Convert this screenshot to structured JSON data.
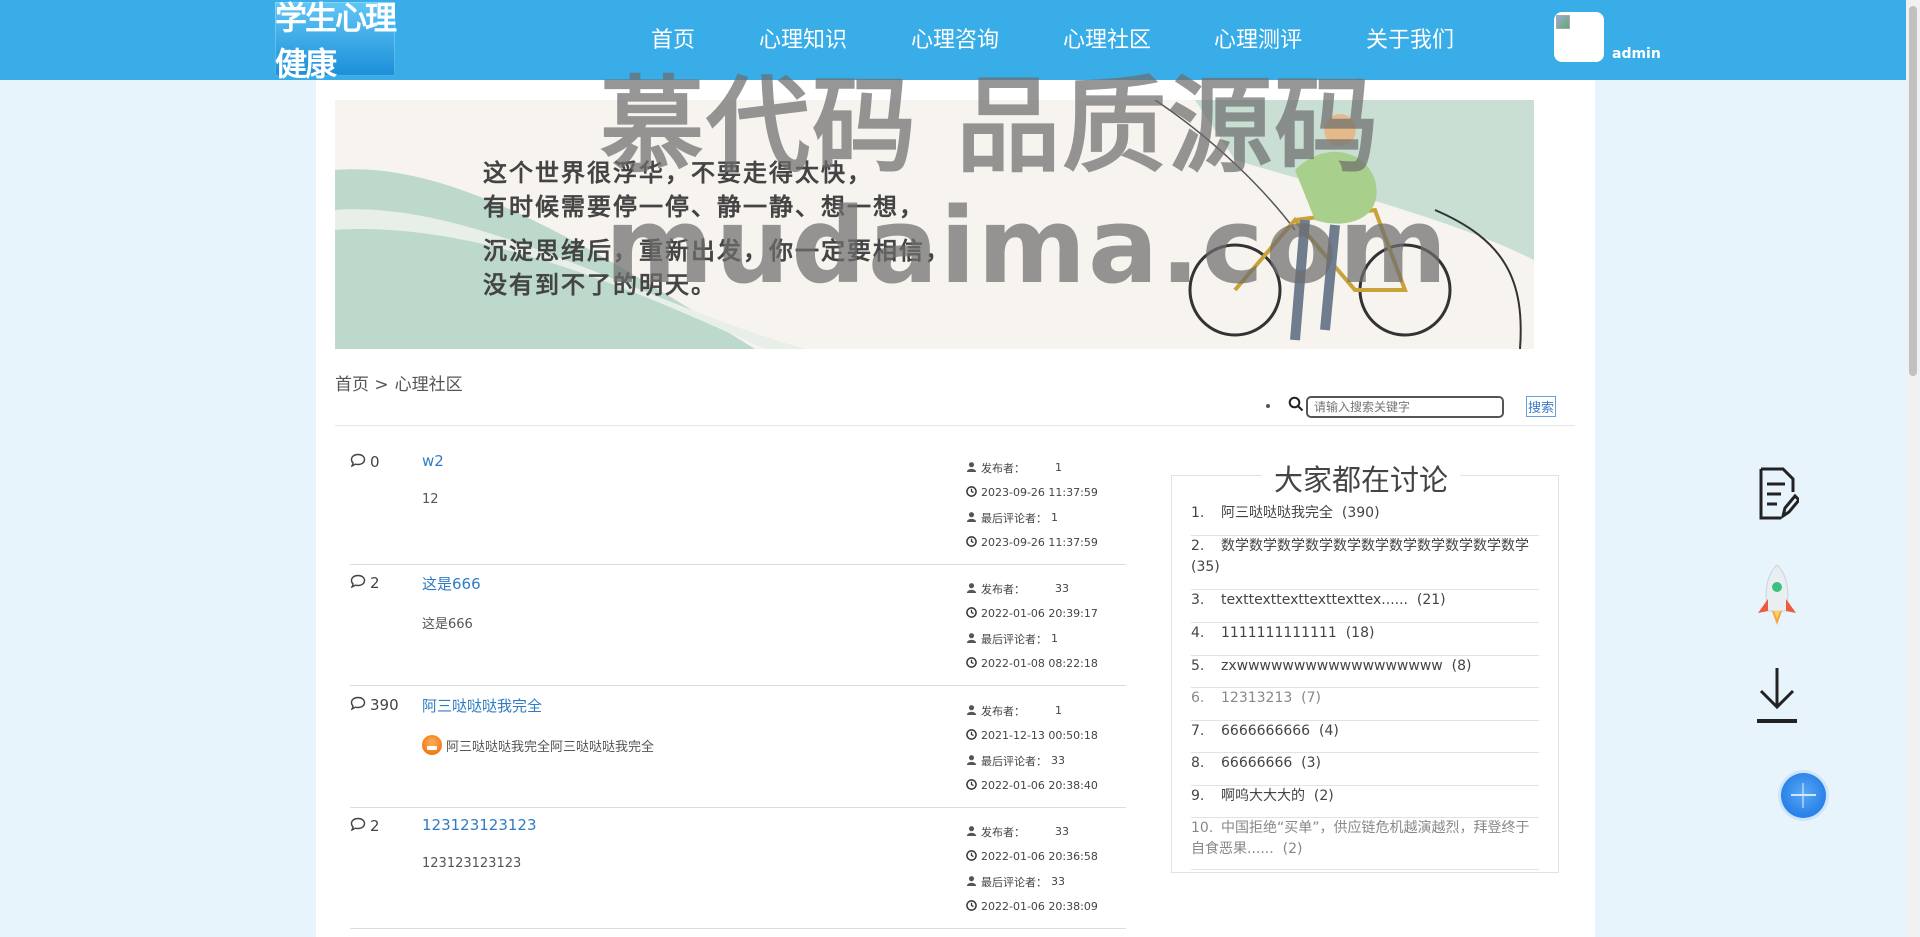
{
  "header": {
    "logo_text": "学生心理健康",
    "nav": [
      "首页",
      "心理知识",
      "心理咨询",
      "心理社区",
      "心理测评",
      "关于我们"
    ],
    "username": "admin"
  },
  "banner": {
    "lines": [
      "这个世界很浮华，不要走得太快，",
      "有时候需要停一停、静一静、想一想，",
      "沉淀思绪后，重新出发，你一定要相信，",
      "没有到不了的明天。"
    ]
  },
  "watermark": {
    "line1": "慕代码 品质源码",
    "line2": "mudaima.com"
  },
  "breadcrumb": {
    "home": "首页 >",
    "current": "心理社区"
  },
  "search": {
    "placeholder": "请输入搜索关键字",
    "button": "搜索"
  },
  "meta_labels": {
    "publisher": "发布者：",
    "last_commenter": "最后评论者："
  },
  "posts": [
    {
      "comments": "0",
      "title": "w2",
      "body": "12",
      "publisher": "1",
      "publish_time": "2023-09-26 11:37:59",
      "last_commenter": "1",
      "last_time": "2023-09-26 11:37:59"
    },
    {
      "comments": "2",
      "title": "这是666",
      "body": "这是666",
      "publisher": "33",
      "publish_time": "2022-01-06 20:39:17",
      "last_commenter": "1",
      "last_time": "2022-01-08 08:22:18"
    },
    {
      "comments": "390",
      "title": "阿三哒哒哒我完全",
      "body": "阿三哒哒哒我完全阿三哒哒哒我完全",
      "publisher": "1",
      "publish_time": "2021-12-13 00:50:18",
      "last_commenter": "33",
      "last_time": "2022-01-06 20:38:40"
    },
    {
      "comments": "2",
      "title": "123123123123",
      "body": "123123123123",
      "publisher": "33",
      "publish_time": "2022-01-06 20:36:58",
      "last_commenter": "33",
      "last_time": "2022-01-06 20:38:09"
    }
  ],
  "discussion": {
    "title": "大家都在讨论",
    "items": [
      {
        "num": "1.",
        "text": "阿三哒哒哒我完全",
        "count": "(390)"
      },
      {
        "num": "2.",
        "text": "数学数学数学数学数学数学数学数学数学数学数学",
        "count": "(35)"
      },
      {
        "num": "3.",
        "text": "texttexttexttexttexttex......",
        "count": "(21)"
      },
      {
        "num": "4.",
        "text": "1111111111111",
        "count": "(18)"
      },
      {
        "num": "5.",
        "text": "zxwwwwwwwwwwwwwwwwww",
        "count": "(8)"
      },
      {
        "num": "6.",
        "text": "12313213",
        "count": "(7)"
      },
      {
        "num": "7.",
        "text": "6666666666",
        "count": "(4)"
      },
      {
        "num": "8.",
        "text": "66666666",
        "count": "(3)"
      },
      {
        "num": "9.",
        "text": "啊呜大大大的",
        "count": "(2)"
      },
      {
        "num": "10.",
        "text": "中国拒绝“买单”，供应链危机越演越烈，拜登终于自食恶果......",
        "count": "(2)"
      }
    ]
  },
  "colors": {
    "header": "#38ade7",
    "link": "#2f7cc5",
    "page_bg": "#e8f4fc"
  }
}
